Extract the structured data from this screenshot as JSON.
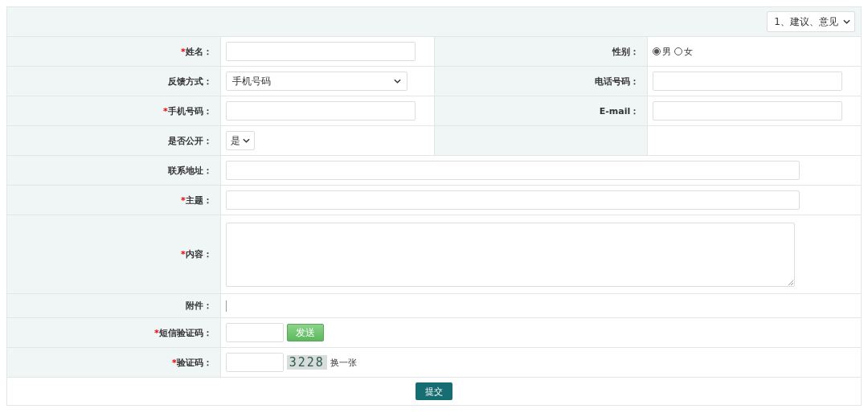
{
  "type_select": {
    "value": "1、建议、意见"
  },
  "rows": [
    {
      "kind": "pair",
      "fields": [
        {
          "label": "姓名：",
          "mark": "*",
          "kind": "text"
        },
        {
          "label": "性别：",
          "kind": "radio",
          "options": [
            {
              "label": "男",
              "selected": true
            },
            {
              "label": "女",
              "selected": false
            }
          ]
        }
      ]
    },
    {
      "kind": "pair",
      "fields": [
        {
          "label": "反馈方式：",
          "kind": "select",
          "value": "手机号码"
        },
        {
          "label": "电话号码：",
          "kind": "text"
        }
      ]
    },
    {
      "kind": "pair",
      "fields": [
        {
          "label": "手机号码：",
          "mark": "*",
          "kind": "text"
        },
        {
          "label": "E-mail：",
          "kind": "text"
        }
      ]
    },
    {
      "kind": "pair",
      "fields": [
        {
          "label": "是否公开：",
          "kind": "small-select",
          "value": "是"
        }
      ]
    },
    {
      "kind": "wide",
      "fields": [
        {
          "label": "联系地址：",
          "kind": "text"
        }
      ]
    },
    {
      "kind": "wide",
      "fields": [
        {
          "label": "主题：",
          "mark": "*",
          "kind": "text"
        }
      ]
    },
    {
      "kind": "wide",
      "fields": [
        {
          "label": "内容：",
          "mark": "*",
          "kind": "textarea"
        }
      ]
    },
    {
      "kind": "wide",
      "fields": [
        {
          "label": "附件：",
          "kind": "file"
        }
      ]
    },
    {
      "kind": "wide",
      "fields": [
        {
          "label": "短信验证码：",
          "mark": "*",
          "kind": "sms",
          "button": "发送"
        }
      ]
    },
    {
      "kind": "wide",
      "fields": [
        {
          "label": "验证码：",
          "mark": "*",
          "kind": "captcha",
          "code": "3228",
          "link": "换一张"
        }
      ]
    }
  ],
  "submit": "提交"
}
